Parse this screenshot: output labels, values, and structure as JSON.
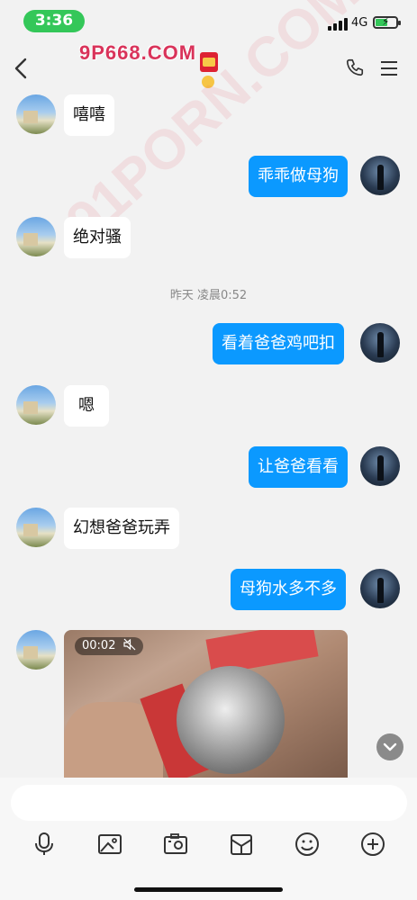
{
  "status": {
    "time": "3:36",
    "network": "4G"
  },
  "header": {
    "watermark_logo": "9P668.COM"
  },
  "watermark_text": "91PORN.COM",
  "timestamp": "昨天 凌晨0:52",
  "messages": [
    {
      "side": "in",
      "text": "嘻嘻"
    },
    {
      "side": "out",
      "text": "乖乖做母狗"
    },
    {
      "side": "in",
      "text": "绝对骚"
    },
    {
      "side": "out",
      "text": "看着爸爸鸡吧扣"
    },
    {
      "side": "in",
      "text": "嗯"
    },
    {
      "side": "out",
      "text": "让爸爸看看"
    },
    {
      "side": "in",
      "text": "幻想爸爸玩弄"
    },
    {
      "side": "out",
      "text": "母狗水多不多"
    }
  ],
  "video": {
    "duration": "00:02"
  },
  "composer": {
    "placeholder": ""
  },
  "toolbar": [
    "microphone-icon",
    "image-icon",
    "camera-icon",
    "gift-icon",
    "emoji-icon",
    "plus-icon"
  ],
  "colors": {
    "out_bubble": "#0b99ff",
    "in_bubble": "#ffffff",
    "time_pill": "#34c759"
  }
}
